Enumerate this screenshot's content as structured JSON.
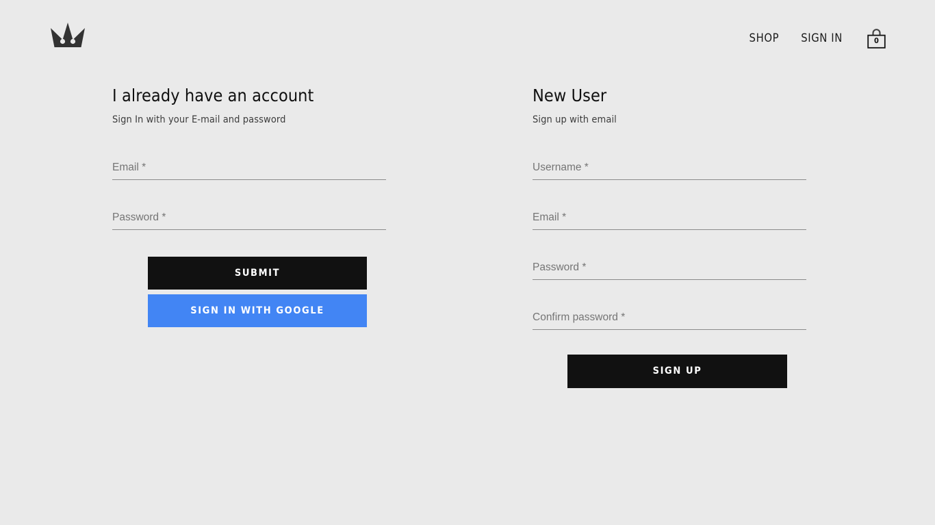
{
  "page": {
    "background_color": "#eaeaea",
    "accent_google_blue": "#4285f4",
    "button_dark": "#111111"
  },
  "header": {
    "logo_icon": "crown-logo-icon",
    "nav": [
      {
        "label": "SHOP",
        "name": "shop"
      },
      {
        "label": "SIGN IN",
        "name": "sign-in"
      }
    ],
    "cart": {
      "icon": "shopping-bag-icon",
      "count": "0"
    }
  },
  "signin": {
    "title": "I already have an account",
    "subtitle": "Sign In with your E-mail and password",
    "fields": [
      {
        "name": "email",
        "placeholder": "Email *",
        "value": ""
      },
      {
        "name": "password",
        "placeholder": "Password *",
        "value": ""
      }
    ],
    "submit_label": "SUBMIT",
    "google_label": "SIGN IN WITH GOOGLE"
  },
  "signup": {
    "title": "New User",
    "subtitle": "Sign up with email",
    "fields": [
      {
        "name": "username",
        "placeholder": "Username *",
        "value": ""
      },
      {
        "name": "email",
        "placeholder": "Email *",
        "value": ""
      },
      {
        "name": "password",
        "placeholder": "Password *",
        "value": ""
      },
      {
        "name": "confirm-password",
        "placeholder": "Confirm password *",
        "value": ""
      }
    ],
    "submit_label": "SIGN UP"
  }
}
